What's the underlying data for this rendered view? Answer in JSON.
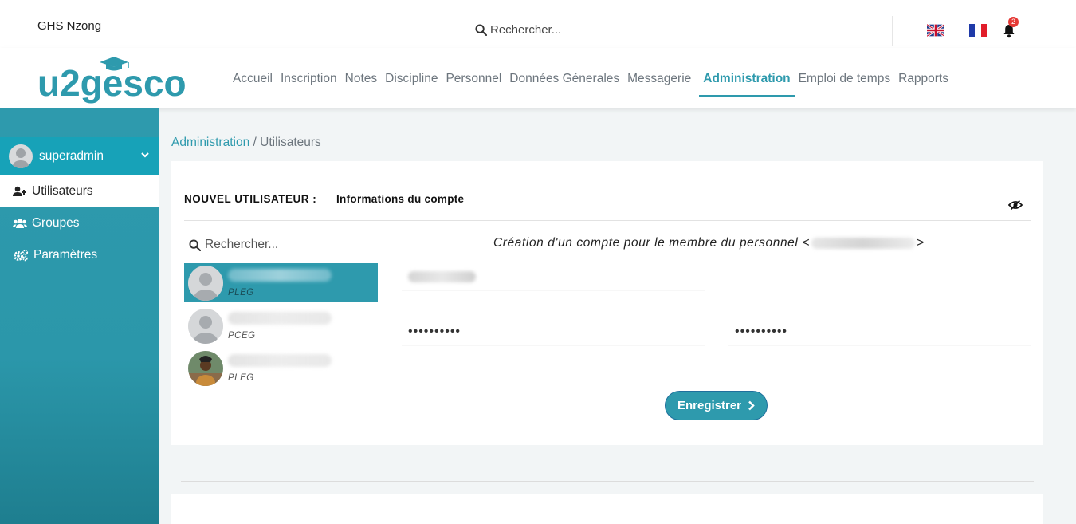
{
  "top": {
    "school": "GHS Nzong",
    "search_placeholder": "Rechercher...",
    "notification_count": "2",
    "icons": [
      "uk-flag-icon",
      "france-flag-icon",
      "bell-icon",
      "search-icon"
    ]
  },
  "nav": {
    "logo_text": "u2gesco",
    "items": [
      {
        "label": "Accueil",
        "active": false
      },
      {
        "label": "Inscription",
        "active": false
      },
      {
        "label": "Notes",
        "active": false
      },
      {
        "label": "Discipline",
        "active": false
      },
      {
        "label": "Personnel",
        "active": false
      },
      {
        "label": "Données Génerales",
        "active": false
      },
      {
        "label": "Messagerie",
        "active": false
      },
      {
        "label": "Administration",
        "active": true
      },
      {
        "label": "Emploi de temps",
        "active": false
      },
      {
        "label": "Rapports",
        "active": false
      }
    ]
  },
  "sidebar": {
    "user": "superadmin",
    "items": [
      {
        "label": "Utilisateurs",
        "icon": "user-plus-icon",
        "active": true
      },
      {
        "label": "Groupes",
        "icon": "users-icon",
        "active": false
      },
      {
        "label": "Paramètres",
        "icon": "cogs-icon",
        "active": false
      }
    ]
  },
  "breadcrumb": {
    "parent": "Administration",
    "separator": " / ",
    "current": "Utilisateurs"
  },
  "card": {
    "title": "NOUVEL UTILISATEUR :",
    "subtitle": "Informations du compte",
    "search_placeholder": "Rechercher...",
    "persons": [
      {
        "grade": "PLEG",
        "selected": true
      },
      {
        "grade": "PCEG",
        "selected": false
      },
      {
        "grade": "PLEG",
        "selected": false
      }
    ],
    "form_title_prefix": "Création d'un compte pour le membre du personnel <",
    "form_title_suffix": ">",
    "password_mask": "••••••••••",
    "password_confirm_mask": "••••••••••",
    "save_label": "Enregistrer"
  },
  "colors": {
    "accent": "#2e9aad",
    "sidebar_pill": "#17a2b8",
    "badge": "#e53935"
  }
}
